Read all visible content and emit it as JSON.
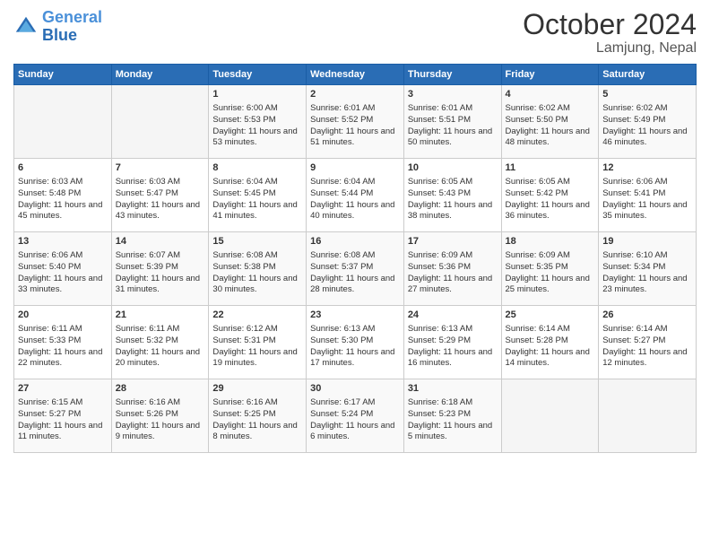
{
  "header": {
    "logo_line1": "General",
    "logo_line2": "Blue",
    "month": "October 2024",
    "location": "Lamjung, Nepal"
  },
  "days_of_week": [
    "Sunday",
    "Monday",
    "Tuesday",
    "Wednesday",
    "Thursday",
    "Friday",
    "Saturday"
  ],
  "weeks": [
    [
      {
        "day": "",
        "sunrise": "",
        "sunset": "",
        "daylight": ""
      },
      {
        "day": "",
        "sunrise": "",
        "sunset": "",
        "daylight": ""
      },
      {
        "day": "1",
        "sunrise": "Sunrise: 6:00 AM",
        "sunset": "Sunset: 5:53 PM",
        "daylight": "Daylight: 11 hours and 53 minutes."
      },
      {
        "day": "2",
        "sunrise": "Sunrise: 6:01 AM",
        "sunset": "Sunset: 5:52 PM",
        "daylight": "Daylight: 11 hours and 51 minutes."
      },
      {
        "day": "3",
        "sunrise": "Sunrise: 6:01 AM",
        "sunset": "Sunset: 5:51 PM",
        "daylight": "Daylight: 11 hours and 50 minutes."
      },
      {
        "day": "4",
        "sunrise": "Sunrise: 6:02 AM",
        "sunset": "Sunset: 5:50 PM",
        "daylight": "Daylight: 11 hours and 48 minutes."
      },
      {
        "day": "5",
        "sunrise": "Sunrise: 6:02 AM",
        "sunset": "Sunset: 5:49 PM",
        "daylight": "Daylight: 11 hours and 46 minutes."
      }
    ],
    [
      {
        "day": "6",
        "sunrise": "Sunrise: 6:03 AM",
        "sunset": "Sunset: 5:48 PM",
        "daylight": "Daylight: 11 hours and 45 minutes."
      },
      {
        "day": "7",
        "sunrise": "Sunrise: 6:03 AM",
        "sunset": "Sunset: 5:47 PM",
        "daylight": "Daylight: 11 hours and 43 minutes."
      },
      {
        "day": "8",
        "sunrise": "Sunrise: 6:04 AM",
        "sunset": "Sunset: 5:45 PM",
        "daylight": "Daylight: 11 hours and 41 minutes."
      },
      {
        "day": "9",
        "sunrise": "Sunrise: 6:04 AM",
        "sunset": "Sunset: 5:44 PM",
        "daylight": "Daylight: 11 hours and 40 minutes."
      },
      {
        "day": "10",
        "sunrise": "Sunrise: 6:05 AM",
        "sunset": "Sunset: 5:43 PM",
        "daylight": "Daylight: 11 hours and 38 minutes."
      },
      {
        "day": "11",
        "sunrise": "Sunrise: 6:05 AM",
        "sunset": "Sunset: 5:42 PM",
        "daylight": "Daylight: 11 hours and 36 minutes."
      },
      {
        "day": "12",
        "sunrise": "Sunrise: 6:06 AM",
        "sunset": "Sunset: 5:41 PM",
        "daylight": "Daylight: 11 hours and 35 minutes."
      }
    ],
    [
      {
        "day": "13",
        "sunrise": "Sunrise: 6:06 AM",
        "sunset": "Sunset: 5:40 PM",
        "daylight": "Daylight: 11 hours and 33 minutes."
      },
      {
        "day": "14",
        "sunrise": "Sunrise: 6:07 AM",
        "sunset": "Sunset: 5:39 PM",
        "daylight": "Daylight: 11 hours and 31 minutes."
      },
      {
        "day": "15",
        "sunrise": "Sunrise: 6:08 AM",
        "sunset": "Sunset: 5:38 PM",
        "daylight": "Daylight: 11 hours and 30 minutes."
      },
      {
        "day": "16",
        "sunrise": "Sunrise: 6:08 AM",
        "sunset": "Sunset: 5:37 PM",
        "daylight": "Daylight: 11 hours and 28 minutes."
      },
      {
        "day": "17",
        "sunrise": "Sunrise: 6:09 AM",
        "sunset": "Sunset: 5:36 PM",
        "daylight": "Daylight: 11 hours and 27 minutes."
      },
      {
        "day": "18",
        "sunrise": "Sunrise: 6:09 AM",
        "sunset": "Sunset: 5:35 PM",
        "daylight": "Daylight: 11 hours and 25 minutes."
      },
      {
        "day": "19",
        "sunrise": "Sunrise: 6:10 AM",
        "sunset": "Sunset: 5:34 PM",
        "daylight": "Daylight: 11 hours and 23 minutes."
      }
    ],
    [
      {
        "day": "20",
        "sunrise": "Sunrise: 6:11 AM",
        "sunset": "Sunset: 5:33 PM",
        "daylight": "Daylight: 11 hours and 22 minutes."
      },
      {
        "day": "21",
        "sunrise": "Sunrise: 6:11 AM",
        "sunset": "Sunset: 5:32 PM",
        "daylight": "Daylight: 11 hours and 20 minutes."
      },
      {
        "day": "22",
        "sunrise": "Sunrise: 6:12 AM",
        "sunset": "Sunset: 5:31 PM",
        "daylight": "Daylight: 11 hours and 19 minutes."
      },
      {
        "day": "23",
        "sunrise": "Sunrise: 6:13 AM",
        "sunset": "Sunset: 5:30 PM",
        "daylight": "Daylight: 11 hours and 17 minutes."
      },
      {
        "day": "24",
        "sunrise": "Sunrise: 6:13 AM",
        "sunset": "Sunset: 5:29 PM",
        "daylight": "Daylight: 11 hours and 16 minutes."
      },
      {
        "day": "25",
        "sunrise": "Sunrise: 6:14 AM",
        "sunset": "Sunset: 5:28 PM",
        "daylight": "Daylight: 11 hours and 14 minutes."
      },
      {
        "day": "26",
        "sunrise": "Sunrise: 6:14 AM",
        "sunset": "Sunset: 5:27 PM",
        "daylight": "Daylight: 11 hours and 12 minutes."
      }
    ],
    [
      {
        "day": "27",
        "sunrise": "Sunrise: 6:15 AM",
        "sunset": "Sunset: 5:27 PM",
        "daylight": "Daylight: 11 hours and 11 minutes."
      },
      {
        "day": "28",
        "sunrise": "Sunrise: 6:16 AM",
        "sunset": "Sunset: 5:26 PM",
        "daylight": "Daylight: 11 hours and 9 minutes."
      },
      {
        "day": "29",
        "sunrise": "Sunrise: 6:16 AM",
        "sunset": "Sunset: 5:25 PM",
        "daylight": "Daylight: 11 hours and 8 minutes."
      },
      {
        "day": "30",
        "sunrise": "Sunrise: 6:17 AM",
        "sunset": "Sunset: 5:24 PM",
        "daylight": "Daylight: 11 hours and 6 minutes."
      },
      {
        "day": "31",
        "sunrise": "Sunrise: 6:18 AM",
        "sunset": "Sunset: 5:23 PM",
        "daylight": "Daylight: 11 hours and 5 minutes."
      },
      {
        "day": "",
        "sunrise": "",
        "sunset": "",
        "daylight": ""
      },
      {
        "day": "",
        "sunrise": "",
        "sunset": "",
        "daylight": ""
      }
    ]
  ]
}
